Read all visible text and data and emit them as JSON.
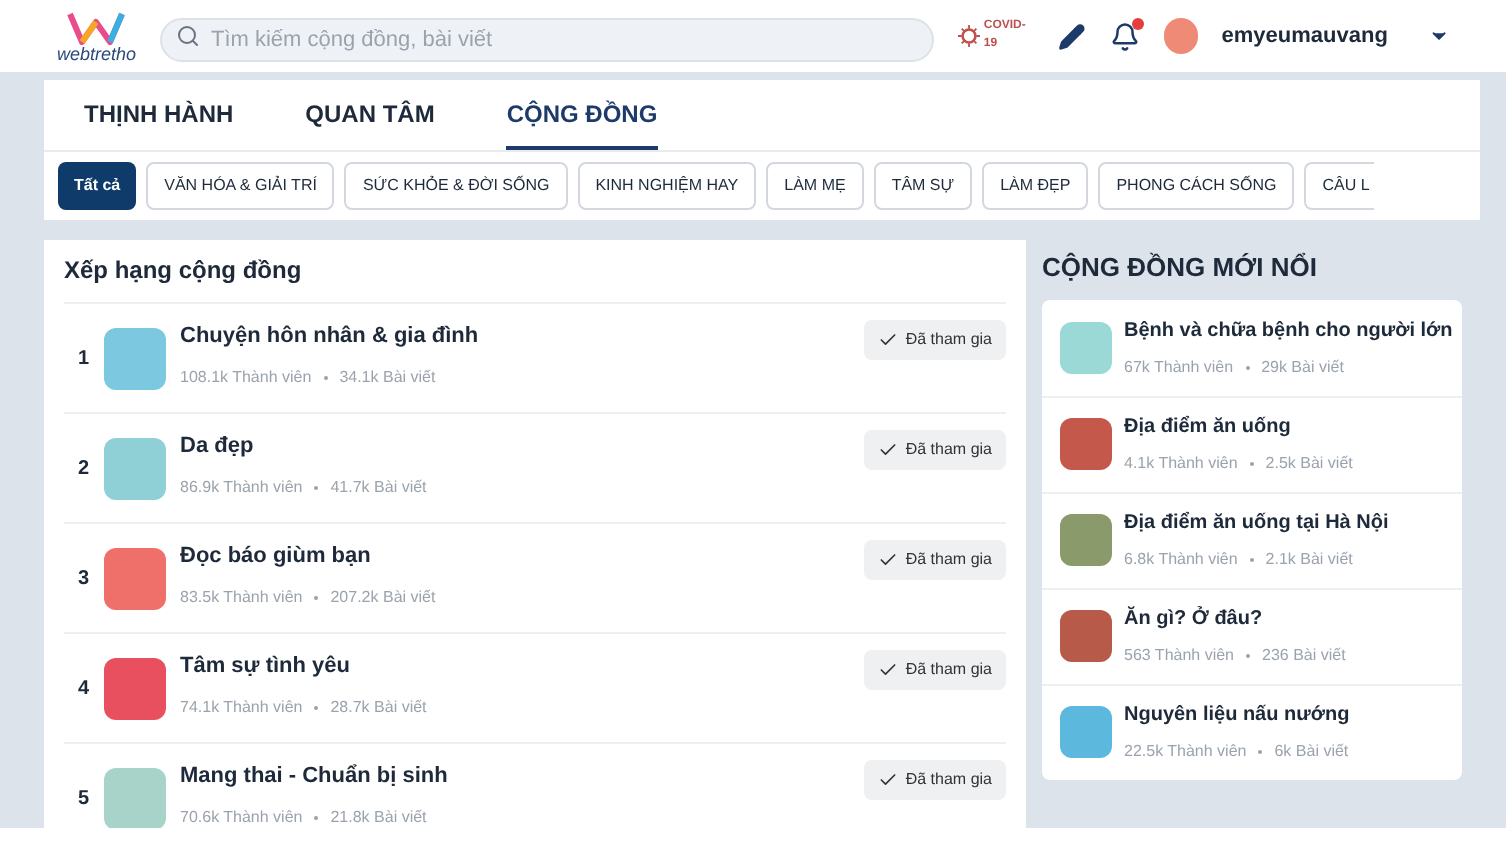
{
  "header": {
    "logo": "webtretho",
    "search": {
      "placeholder": "Tìm kiếm cộng đồng, bài viết"
    },
    "covid_badge": "COVID-19",
    "notifications_unread": true,
    "username": "emyeumauvang"
  },
  "tabs": [
    {
      "label": "THỊNH HÀNH",
      "selected": false
    },
    {
      "label": "QUAN TÂM",
      "selected": false
    },
    {
      "label": "CỘNG ĐỒNG",
      "selected": true
    }
  ],
  "categories": [
    {
      "label": "Tất cả",
      "selected": true
    },
    {
      "label": "VĂN HÓA & GIẢI TRÍ",
      "selected": false
    },
    {
      "label": "SỨC KHỎE & ĐỜI SỐNG",
      "selected": false
    },
    {
      "label": "KINH NGHIỆM HAY",
      "selected": false
    },
    {
      "label": "LÀM MẸ",
      "selected": false
    },
    {
      "label": "TÂM SỰ",
      "selected": false
    },
    {
      "label": "LÀM ĐẸP",
      "selected": false
    },
    {
      "label": "PHONG CÁCH SỐNG",
      "selected": false
    },
    {
      "label": "CÂU L",
      "selected": false
    }
  ],
  "ranking": {
    "title": "Xếp hạng cộng đồng",
    "rows": [
      {
        "rank": "1",
        "name": "Chuyện hôn nhân & gia đình",
        "members": "108.1k Thành viên",
        "posts": "34.1k Bài viết",
        "joined": true,
        "action": "Đã tham gia"
      },
      {
        "rank": "2",
        "name": "Da đẹp",
        "members": "86.9k Thành viên",
        "posts": "41.7k Bài viết",
        "joined": true,
        "action": "Đã tham gia"
      },
      {
        "rank": "3",
        "name": "Đọc báo giùm bạn",
        "members": "83.5k Thành viên",
        "posts": "207.2k Bài viết",
        "joined": true,
        "action": "Đã tham gia"
      },
      {
        "rank": "4",
        "name": "Tâm sự tình yêu",
        "members": "74.1k Thành viên",
        "posts": "28.7k Bài viết",
        "joined": true,
        "action": "Đã tham gia"
      },
      {
        "rank": "5",
        "name": "Mang thai - Chuẩn bị sinh",
        "members": "70.6k Thành viên",
        "posts": "21.8k Bài viết",
        "joined": true,
        "action": "Đã tham gia"
      }
    ]
  },
  "emerging": {
    "title": "CỘNG ĐỒNG MỚI NỔI",
    "items": [
      {
        "name": "Bệnh và chữa bệnh cho người lớn",
        "members": "67k Thành viên",
        "posts": "29k Bài viết"
      },
      {
        "name": "Địa điểm ăn uống",
        "members": "4.1k Thành viên",
        "posts": "2.5k Bài viết"
      },
      {
        "name": "Địa điểm ăn uống tại Hà Nội",
        "members": "6.8k Thành viên",
        "posts": "2.1k Bài viết"
      },
      {
        "name": "Ăn gì? Ở đâu?",
        "members": "563 Thành viên",
        "posts": "236 Bài viết"
      },
      {
        "name": "Nguyên liệu nấu nướng",
        "members": "22.5k Thành viên",
        "posts": "6k Bài viết"
      }
    ]
  }
}
